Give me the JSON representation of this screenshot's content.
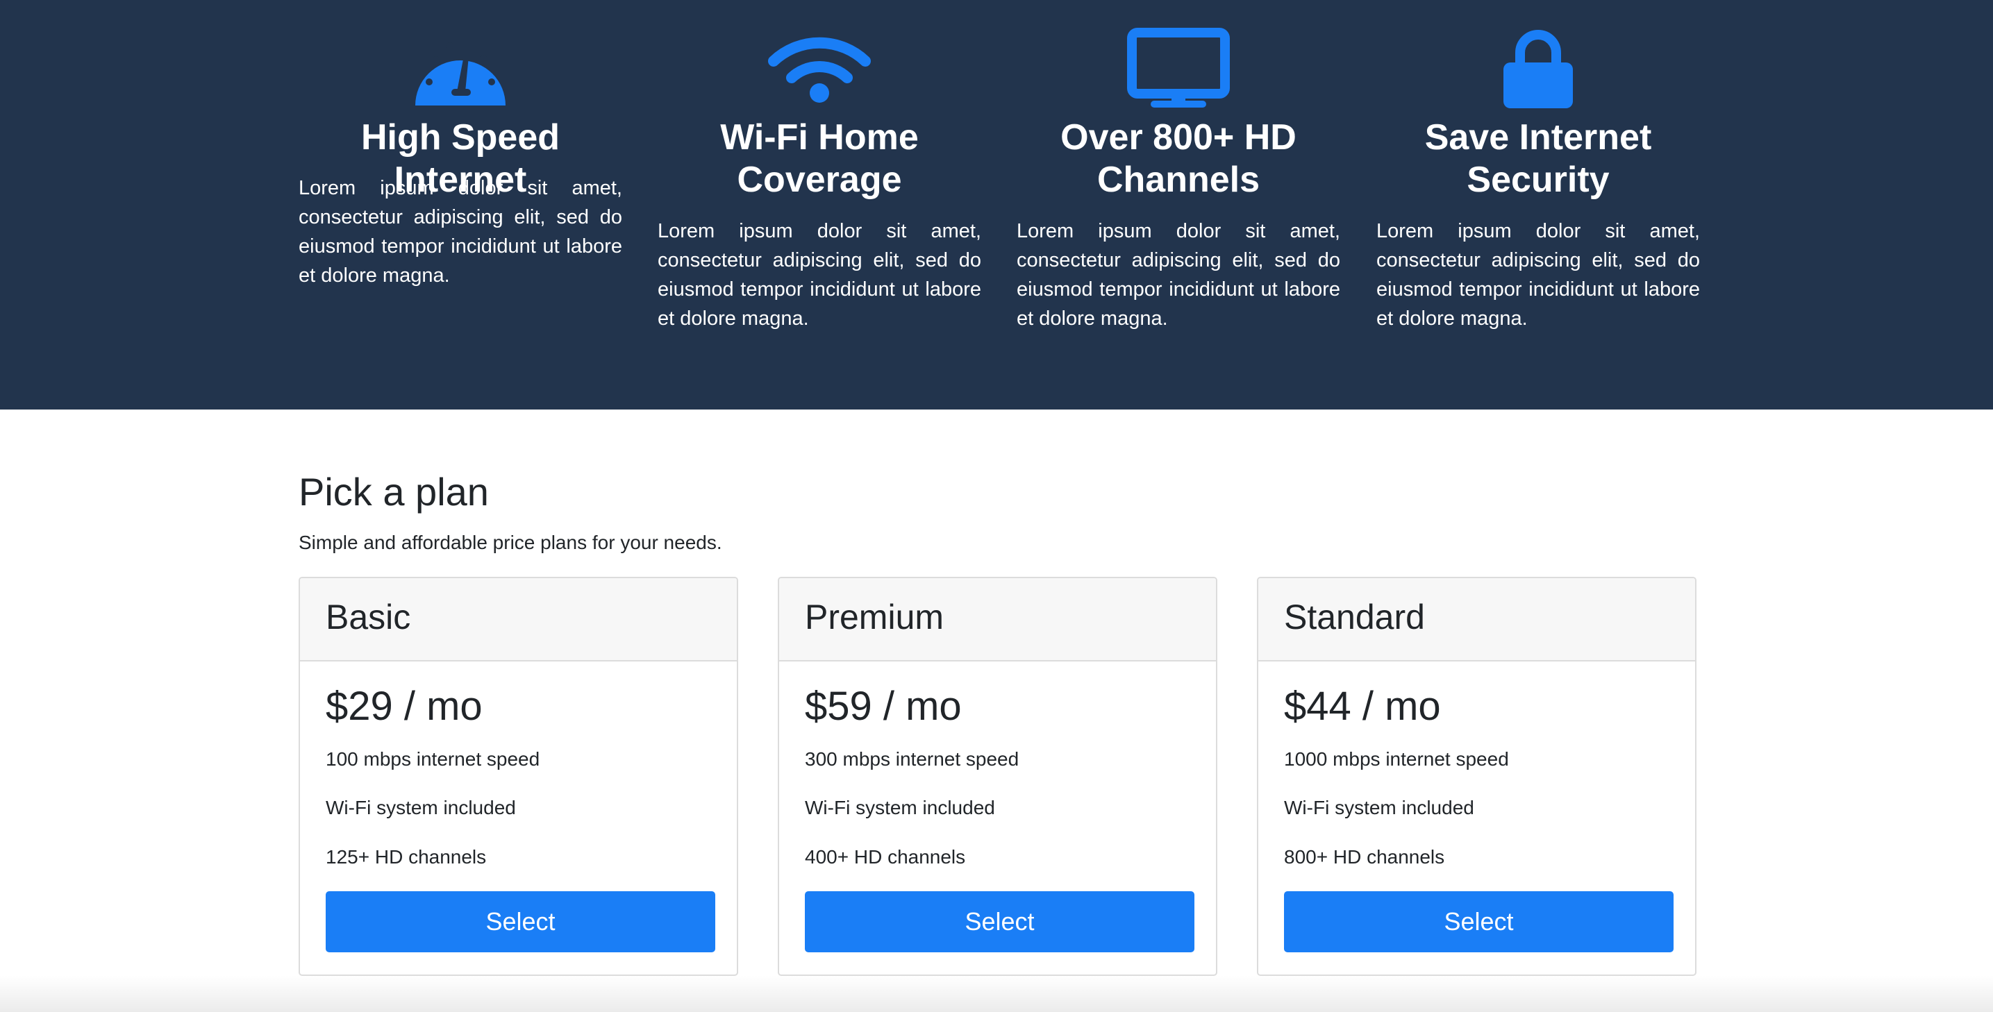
{
  "colors": {
    "header_bg": "#22344d",
    "accent": "#1a7ef6",
    "text": "#212529"
  },
  "features": [
    {
      "icon": "speedometer-icon",
      "title_lines": [
        "High Speed Internet"
      ],
      "description": "Lorem ipsum dolor sit amet, consectetur adipiscing elit, sed do eiusmod tempor incididunt ut labore et dolore magna."
    },
    {
      "icon": "wifi-icon",
      "title_lines": [
        "Wi-Fi Home",
        "Coverage"
      ],
      "description": "Lorem ipsum dolor sit amet, consectetur adipiscing elit, sed do eiusmod tempor incididunt ut labore et dolore magna."
    },
    {
      "icon": "tv-icon",
      "title_lines": [
        "Over 800+ HD",
        "Channels"
      ],
      "description": "Lorem ipsum dolor sit amet, consectetur adipiscing elit, sed do eiusmod tempor incididunt ut labore et dolore magna."
    },
    {
      "icon": "lock-icon",
      "title_lines": [
        "Save Internet",
        "Security"
      ],
      "description": "Lorem ipsum dolor sit amet, consectetur adipiscing elit, sed do eiusmod tempor incididunt ut labore et dolore magna."
    }
  ],
  "plans_section": {
    "heading": "Pick a plan",
    "subheading": "Simple and affordable price plans for your needs.",
    "plans": [
      {
        "name": "Basic",
        "price": "$29 / mo",
        "features": [
          "100 mbps internet speed",
          "Wi-Fi system included",
          "125+ HD channels"
        ],
        "button_label": "Select"
      },
      {
        "name": "Premium",
        "price": "$59 / mo",
        "features": [
          "300 mbps internet speed",
          "Wi-Fi system included",
          "400+ HD channels"
        ],
        "button_label": "Select"
      },
      {
        "name": "Standard",
        "price": "$44 / mo",
        "features": [
          "1000 mbps internet speed",
          "Wi-Fi system included",
          "800+ HD channels"
        ],
        "button_label": "Select"
      }
    ]
  }
}
